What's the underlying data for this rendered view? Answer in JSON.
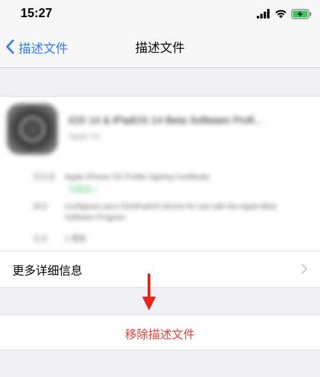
{
  "status_bar": {
    "time": "15:27",
    "icons": [
      "cellular-signal-icon",
      "wifi-icon",
      "battery-charging-icon"
    ]
  },
  "nav": {
    "back_label": "描述文件",
    "title": "描述文件"
  },
  "profile": {
    "name": "iOS 14 & iPadOS 14 Beta Software Profi...",
    "organization": "Apple Inc.",
    "details": [
      {
        "key": "签名者",
        "value": "Apple iPhone OS Profile Signing Certificate"
      },
      {
        "key": "",
        "value": "已验证 ✓"
      },
      {
        "key": "描述",
        "value": "Configures your iOS/iPadOS device for use with the Apple Beta Software Program"
      },
      {
        "key": "包含",
        "value": "1 项目"
      }
    ]
  },
  "more_info": {
    "label": "更多详细信息"
  },
  "remove": {
    "label": "移除描述文件"
  },
  "colors": {
    "accent": "#2f7cf6",
    "destructive": "#e0453a",
    "annotation": "#e3271b",
    "battery": "#34c759"
  }
}
